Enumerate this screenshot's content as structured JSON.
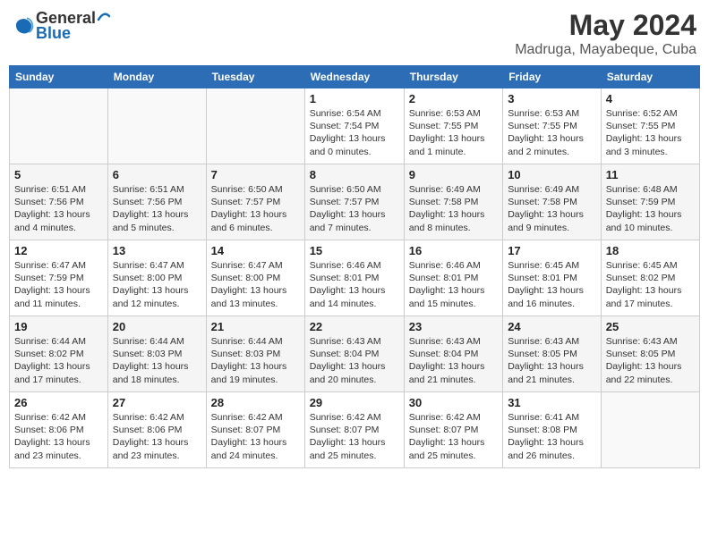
{
  "logo": {
    "general": "General",
    "blue": "Blue"
  },
  "title": "May 2024",
  "location": "Madruga, Mayabeque, Cuba",
  "weekdays": [
    "Sunday",
    "Monday",
    "Tuesday",
    "Wednesday",
    "Thursday",
    "Friday",
    "Saturday"
  ],
  "weeks": [
    [
      {
        "day": "",
        "info": ""
      },
      {
        "day": "",
        "info": ""
      },
      {
        "day": "",
        "info": ""
      },
      {
        "day": "1",
        "info": "Sunrise: 6:54 AM\nSunset: 7:54 PM\nDaylight: 13 hours\nand 0 minutes."
      },
      {
        "day": "2",
        "info": "Sunrise: 6:53 AM\nSunset: 7:55 PM\nDaylight: 13 hours\nand 1 minute."
      },
      {
        "day": "3",
        "info": "Sunrise: 6:53 AM\nSunset: 7:55 PM\nDaylight: 13 hours\nand 2 minutes."
      },
      {
        "day": "4",
        "info": "Sunrise: 6:52 AM\nSunset: 7:55 PM\nDaylight: 13 hours\nand 3 minutes."
      }
    ],
    [
      {
        "day": "5",
        "info": "Sunrise: 6:51 AM\nSunset: 7:56 PM\nDaylight: 13 hours\nand 4 minutes."
      },
      {
        "day": "6",
        "info": "Sunrise: 6:51 AM\nSunset: 7:56 PM\nDaylight: 13 hours\nand 5 minutes."
      },
      {
        "day": "7",
        "info": "Sunrise: 6:50 AM\nSunset: 7:57 PM\nDaylight: 13 hours\nand 6 minutes."
      },
      {
        "day": "8",
        "info": "Sunrise: 6:50 AM\nSunset: 7:57 PM\nDaylight: 13 hours\nand 7 minutes."
      },
      {
        "day": "9",
        "info": "Sunrise: 6:49 AM\nSunset: 7:58 PM\nDaylight: 13 hours\nand 8 minutes."
      },
      {
        "day": "10",
        "info": "Sunrise: 6:49 AM\nSunset: 7:58 PM\nDaylight: 13 hours\nand 9 minutes."
      },
      {
        "day": "11",
        "info": "Sunrise: 6:48 AM\nSunset: 7:59 PM\nDaylight: 13 hours\nand 10 minutes."
      }
    ],
    [
      {
        "day": "12",
        "info": "Sunrise: 6:47 AM\nSunset: 7:59 PM\nDaylight: 13 hours\nand 11 minutes."
      },
      {
        "day": "13",
        "info": "Sunrise: 6:47 AM\nSunset: 8:00 PM\nDaylight: 13 hours\nand 12 minutes."
      },
      {
        "day": "14",
        "info": "Sunrise: 6:47 AM\nSunset: 8:00 PM\nDaylight: 13 hours\nand 13 minutes."
      },
      {
        "day": "15",
        "info": "Sunrise: 6:46 AM\nSunset: 8:01 PM\nDaylight: 13 hours\nand 14 minutes."
      },
      {
        "day": "16",
        "info": "Sunrise: 6:46 AM\nSunset: 8:01 PM\nDaylight: 13 hours\nand 15 minutes."
      },
      {
        "day": "17",
        "info": "Sunrise: 6:45 AM\nSunset: 8:01 PM\nDaylight: 13 hours\nand 16 minutes."
      },
      {
        "day": "18",
        "info": "Sunrise: 6:45 AM\nSunset: 8:02 PM\nDaylight: 13 hours\nand 17 minutes."
      }
    ],
    [
      {
        "day": "19",
        "info": "Sunrise: 6:44 AM\nSunset: 8:02 PM\nDaylight: 13 hours\nand 17 minutes."
      },
      {
        "day": "20",
        "info": "Sunrise: 6:44 AM\nSunset: 8:03 PM\nDaylight: 13 hours\nand 18 minutes."
      },
      {
        "day": "21",
        "info": "Sunrise: 6:44 AM\nSunset: 8:03 PM\nDaylight: 13 hours\nand 19 minutes."
      },
      {
        "day": "22",
        "info": "Sunrise: 6:43 AM\nSunset: 8:04 PM\nDaylight: 13 hours\nand 20 minutes."
      },
      {
        "day": "23",
        "info": "Sunrise: 6:43 AM\nSunset: 8:04 PM\nDaylight: 13 hours\nand 21 minutes."
      },
      {
        "day": "24",
        "info": "Sunrise: 6:43 AM\nSunset: 8:05 PM\nDaylight: 13 hours\nand 21 minutes."
      },
      {
        "day": "25",
        "info": "Sunrise: 6:43 AM\nSunset: 8:05 PM\nDaylight: 13 hours\nand 22 minutes."
      }
    ],
    [
      {
        "day": "26",
        "info": "Sunrise: 6:42 AM\nSunset: 8:06 PM\nDaylight: 13 hours\nand 23 minutes."
      },
      {
        "day": "27",
        "info": "Sunrise: 6:42 AM\nSunset: 8:06 PM\nDaylight: 13 hours\nand 23 minutes."
      },
      {
        "day": "28",
        "info": "Sunrise: 6:42 AM\nSunset: 8:07 PM\nDaylight: 13 hours\nand 24 minutes."
      },
      {
        "day": "29",
        "info": "Sunrise: 6:42 AM\nSunset: 8:07 PM\nDaylight: 13 hours\nand 25 minutes."
      },
      {
        "day": "30",
        "info": "Sunrise: 6:42 AM\nSunset: 8:07 PM\nDaylight: 13 hours\nand 25 minutes."
      },
      {
        "day": "31",
        "info": "Sunrise: 6:41 AM\nSunset: 8:08 PM\nDaylight: 13 hours\nand 26 minutes."
      },
      {
        "day": "",
        "info": ""
      }
    ]
  ]
}
